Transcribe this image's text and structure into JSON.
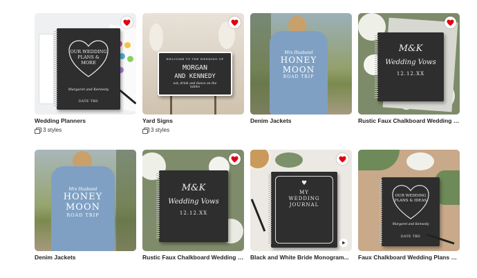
{
  "products": [
    {
      "title": "Wedding Planners",
      "styles": "3 styles",
      "favorited": true
    },
    {
      "title": "Yard Signs",
      "styles": "3 styles",
      "favorited": true
    },
    {
      "title": "Denim Jackets",
      "styles": "",
      "favorited": false
    },
    {
      "title": "Rustic Faux Chalkboard Wedding Vows...",
      "styles": "",
      "favorited": true
    },
    {
      "title": "Denim Jackets",
      "styles": "",
      "favorited": false
    },
    {
      "title": "Rustic Faux Chalkboard Wedding Vows...",
      "styles": "",
      "favorited": true
    },
    {
      "title": "Black and White Bride Monogram...",
      "styles": "",
      "favorited": true
    },
    {
      "title": "Faux Chalkboard Wedding Plans and...",
      "styles": "",
      "favorited": false
    }
  ],
  "art": {
    "planner": {
      "line1": "OUR WEDDING",
      "line2": "PLANS &",
      "line3": "MORE",
      "names": "Margaret and Kennedy",
      "date": "DATE TBD"
    },
    "sign": {
      "welcome": "WELCOME TO THE WEDDING OF",
      "name1": "MORGAN",
      "name2": "AND KENNEDY",
      "tag": "eat, drink and dance on the tables"
    },
    "jacket": {
      "line1": "Mrs Husband",
      "line2": "HONEY",
      "line3": "MOON",
      "line4": "ROAD TRIP"
    },
    "vows": {
      "monogram": "M&K",
      "title": "Wedding Vows",
      "date": "12.12.XX"
    },
    "journal": {
      "line1": "MY",
      "line2": "WEDDING",
      "line3": "JOURNAL"
    },
    "ideas": {
      "line1": "OUR WEDDING",
      "line2": "PLANS & IDEAS",
      "names": "Margaret and Kennedy",
      "date": "DATE TBD"
    }
  },
  "colors": {
    "heart": "#e3000f",
    "chalkboard": "#2e2e2e",
    "denim": "#7fa0c3"
  }
}
